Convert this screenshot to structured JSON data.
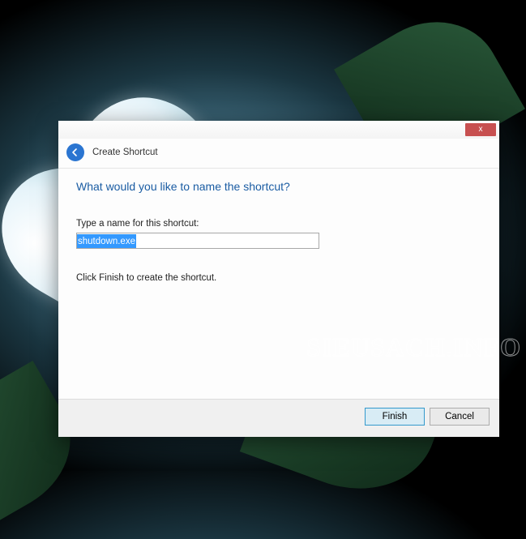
{
  "dialog": {
    "wizard_title": "Create Shortcut",
    "heading": "What would you like to name the shortcut?",
    "input_label": "Type a name for this shortcut:",
    "input_value": "shutdown.exe",
    "instruction": "Click Finish to create the shortcut.",
    "buttons": {
      "finish": "Finish",
      "cancel": "Cancel"
    },
    "close_symbol": "x"
  },
  "watermark": "SIEUSACH.INFO"
}
